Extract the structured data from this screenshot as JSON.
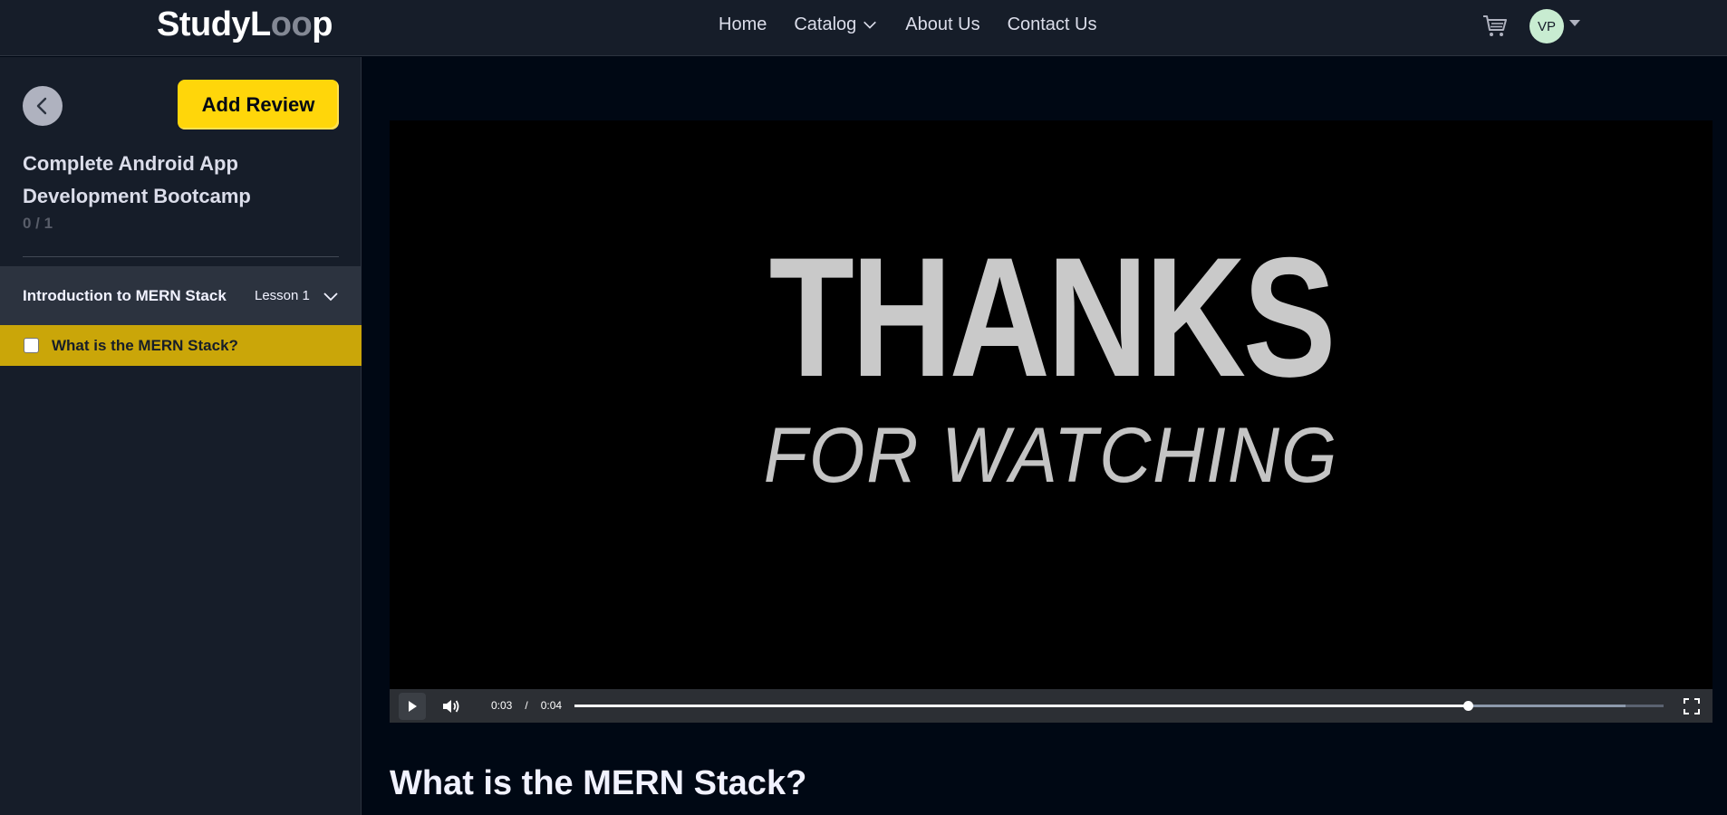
{
  "header": {
    "logo_text_a": "StudyL",
    "logo_text_oo": "oo",
    "logo_text_b": "p",
    "nav": [
      {
        "label": "Home"
      },
      {
        "label": "Catalog",
        "icon": "chevron-down-icon"
      },
      {
        "label": "About Us"
      },
      {
        "label": "Contact Us"
      }
    ],
    "cart_icon": "cart-icon",
    "avatar_initials": "VP"
  },
  "sidebar": {
    "back_icon": "chevron-left-icon",
    "add_review_label": "Add Review",
    "course_title": "Complete Android App Development Bootcamp",
    "progress_text": "0 / 1",
    "sections": [
      {
        "title": "Introduction to MERN Stack",
        "lesson_count": "Lesson 1",
        "expanded": true,
        "lessons": [
          {
            "label": "What is the MERN Stack?",
            "completed": false,
            "active": true
          }
        ]
      }
    ]
  },
  "video": {
    "frame_line1": "THANKS",
    "frame_line2": "FOR WATCHING",
    "current_time": "0:03",
    "separator": "/",
    "duration": "0:04",
    "played_fraction": 0.82,
    "buffered_fraction": 0.965
  },
  "lesson_heading": "What is the MERN Stack?",
  "colors": {
    "accent": "#ffd60a",
    "active_lesson": "#caa609",
    "background": "#000814",
    "panel": "#161d29"
  }
}
